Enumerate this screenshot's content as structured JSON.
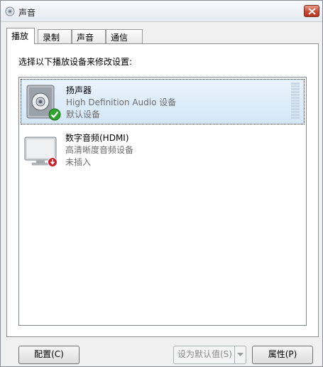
{
  "window": {
    "title": "声音",
    "icon": "speaker-icon",
    "close_icon": "close-icon"
  },
  "tabs": [
    {
      "label": "播放",
      "active": true
    },
    {
      "label": "录制",
      "active": false
    },
    {
      "label": "声音",
      "active": false
    },
    {
      "label": "通信",
      "active": false
    }
  ],
  "instruction": "选择以下播放设备来修改设置:",
  "devices": [
    {
      "name": "扬声器",
      "description": "High Definition Audio 设备",
      "status": "默认设备",
      "icon": "speaker-icon",
      "badge": "green-check-icon",
      "selected": true
    },
    {
      "name": "数字音频(HDMI)",
      "description": "高清晰度音频设备",
      "status": "未插入",
      "icon": "monitor-icon",
      "badge": "red-unplugged-icon",
      "selected": false
    }
  ],
  "buttons": {
    "configure": "配置(C)",
    "set_default": "设为默认值(S)",
    "properties": "属性(P)"
  },
  "colors": {
    "selection": "#d4e7f8",
    "close_button": "#c94a36",
    "default_badge": "#2fa52f",
    "unplugged_badge": "#c8202a"
  }
}
